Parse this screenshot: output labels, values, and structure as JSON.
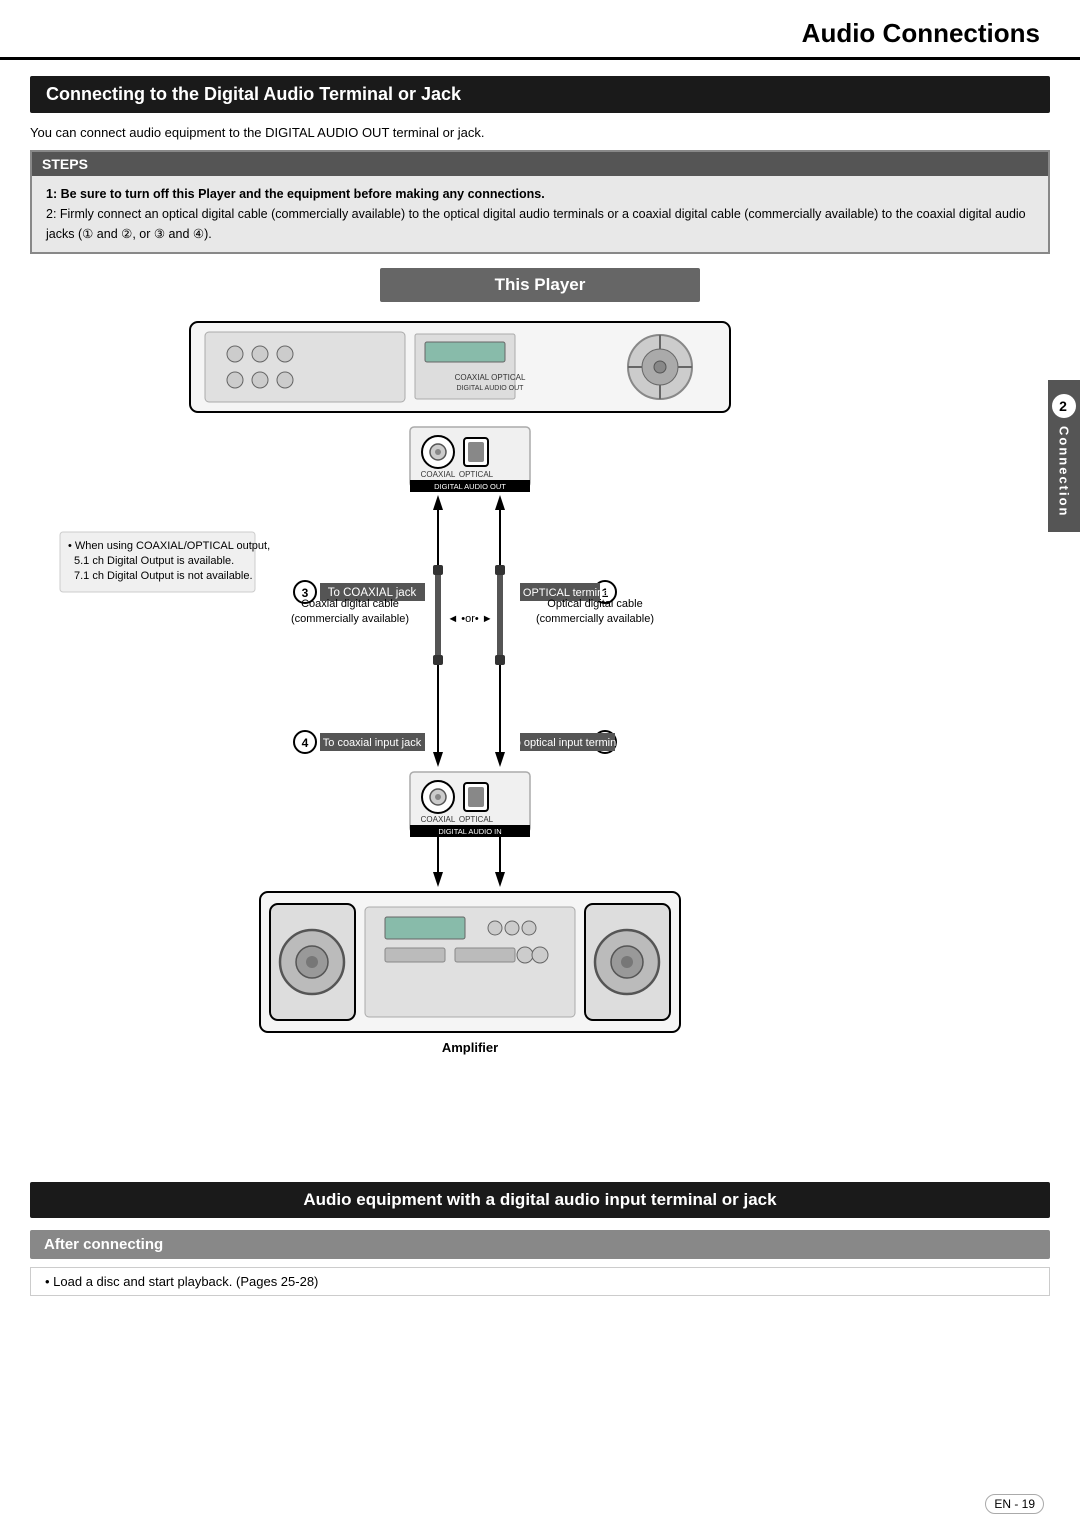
{
  "page": {
    "title": "Audio Connections",
    "page_number": "EN - 19"
  },
  "section1": {
    "heading": "Connecting to the Digital Audio Terminal or Jack",
    "subtitle": "You can connect audio equipment to the DIGITAL AUDIO OUT terminal or jack."
  },
  "steps": {
    "header": "STEPS",
    "step1": "1: Be sure to turn off this Player and the equipment before making any connections.",
    "step2": "2: Firmly connect an optical digital cable (commercially available) to the optical digital audio terminals or a coaxial digital cable (commercially available) to the coaxial digital audio jacks (① and ②, or ③ and ④)."
  },
  "this_player": {
    "label": "This Player"
  },
  "diagram": {
    "note": "When using COAXIAL/OPTICAL output, 5.1 ch Digital Output is available. 7.1 ch Digital Output is not available.",
    "digital_audio_out": "DIGITAL AUDIO OUT",
    "coaxial_label": "COAXIAL",
    "optical_label": "OPTICAL",
    "digital_audio_in": "DIGITAL AUDIO IN",
    "conn3_label": "To COAXIAL jack",
    "conn1_label": "To OPTICAL terminal",
    "conn4_label": "To coaxial input jack",
    "conn2_label": "To optical input terminal",
    "coaxial_cable": "Coaxial digital cable (commercially available)",
    "optical_cable": "Optical digital cable (commercially available)",
    "or_text": "◄ •or• ►",
    "amplifier_label": "Amplifier"
  },
  "audio_equipment": {
    "heading": "Audio equipment with a digital audio input terminal or jack"
  },
  "after_connecting": {
    "header": "After connecting",
    "bullet": "Load a disc and start playback. (Pages 25-28)"
  },
  "sidebar": {
    "number": "2",
    "label": "Connection"
  }
}
